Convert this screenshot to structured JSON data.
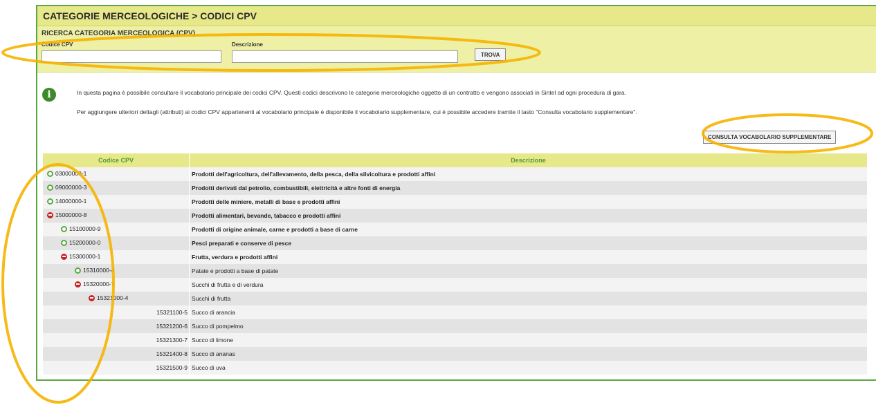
{
  "header": {
    "title": "CATEGORIE MERCEOLOGICHE  > CODICI CPV"
  },
  "search": {
    "section_title": "RICERCA CATEGORIA MERCEOLOGICA (CPV)",
    "code_label": "Codice CPV",
    "code_value": "",
    "desc_label": "Descrizione",
    "desc_value": "",
    "button": "TROVA"
  },
  "info": {
    "line1": "In questa pagina è possibile consultare il vocabolario principale dei codici CPV. Questi codici descrivono le categorie merceologiche oggetto di un contratto e vengono associati in Sintel ad ogni procedura di gara.",
    "line2": "Per aggiungere ulteriori dettagli (attributi) ai codici CPV appartenenti al vocabolario principale è disponibile il vocabolario supplementare, cui è possibile accedere tramite il tasto \"Consulta vocabolario supplementare\".",
    "button": "CONSULTA VOCABOLARIO SUPPLEMENTARE"
  },
  "table": {
    "headers": [
      "Codice CPV",
      "Descrizione"
    ],
    "rows": [
      {
        "code": "03000000-1",
        "desc": "Prodotti dell'agricoltura, dell'allevamento, della pesca, della silvicoltura e prodotti affini",
        "level": 0,
        "toggle": "plus"
      },
      {
        "code": "09000000-3",
        "desc": "Prodotti derivati dal petrolio, combustibili, elettricità e altre fonti di energia",
        "level": 0,
        "toggle": "plus"
      },
      {
        "code": "14000000-1",
        "desc": "Prodotti delle miniere, metalli di base e prodotti affini",
        "level": 0,
        "toggle": "plus"
      },
      {
        "code": "15000000-8",
        "desc": "Prodotti alimentari, bevande, tabacco e prodotti affini",
        "level": 0,
        "toggle": "minus"
      },
      {
        "code": "15100000-9",
        "desc": "Prodotti di origine animale, carne e prodotti a base di carne",
        "level": 1,
        "toggle": "plus"
      },
      {
        "code": "15200000-0",
        "desc": "Pesci preparati e conserve di pesce",
        "level": 1,
        "toggle": "plus"
      },
      {
        "code": "15300000-1",
        "desc": "Frutta, verdura e prodotti affini",
        "level": 1,
        "toggle": "minus"
      },
      {
        "code": "15310000-4",
        "desc": "Patate e prodotti a base di patate",
        "level": 2,
        "toggle": "plus"
      },
      {
        "code": "15320000-7",
        "desc": "Succhi di frutta e di verdura",
        "level": 2,
        "toggle": "minus"
      },
      {
        "code": "15321000-4",
        "desc": "Succhi di frutta",
        "level": 3,
        "toggle": "minus"
      },
      {
        "code": "15321100-5",
        "desc": "Succo di arancia",
        "level": 4,
        "toggle": "none"
      },
      {
        "code": "15321200-6",
        "desc": "Succo di pompelmo",
        "level": 4,
        "toggle": "none"
      },
      {
        "code": "15321300-7",
        "desc": "Succo di limone",
        "level": 4,
        "toggle": "none"
      },
      {
        "code": "15321400-8",
        "desc": "Succo di ananas",
        "level": 4,
        "toggle": "none"
      },
      {
        "code": "15321500-9",
        "desc": "Succo di uva",
        "level": 4,
        "toggle": "none"
      }
    ]
  },
  "icons": {
    "info": "info-icon",
    "expand": "plus-circle-icon",
    "collapse": "minus-circle-icon"
  },
  "colors": {
    "highlight": "#f5b300",
    "accent_green": "#5aa843",
    "header_yellow": "#e6e88a",
    "collapse_red": "#c62424"
  }
}
